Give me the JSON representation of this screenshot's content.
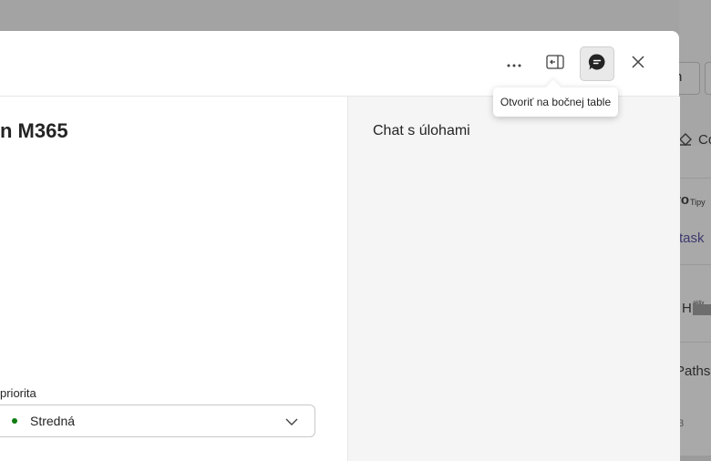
{
  "background": {
    "button_text": "n",
    "section_label": "Co",
    "pro_text": "ro",
    "tipy_text": "Tipy",
    "task_link": "task",
    "item_h": "H",
    "item_h_tiny": "aktiv",
    "paths_text": "Paths,",
    "count_text": "3"
  },
  "dialog": {
    "title": "n M365",
    "priority": {
      "label": "priorita",
      "value": "Stredná",
      "dot_color": "#107c10"
    },
    "chat_panel": {
      "title": "Chat s úlohami"
    },
    "header_icons": {
      "more": "more-icon",
      "side": "open-side-panel-icon",
      "chat": "chat-icon",
      "close": "close-icon"
    },
    "tooltip": "Otvoriť na bočnej table"
  }
}
